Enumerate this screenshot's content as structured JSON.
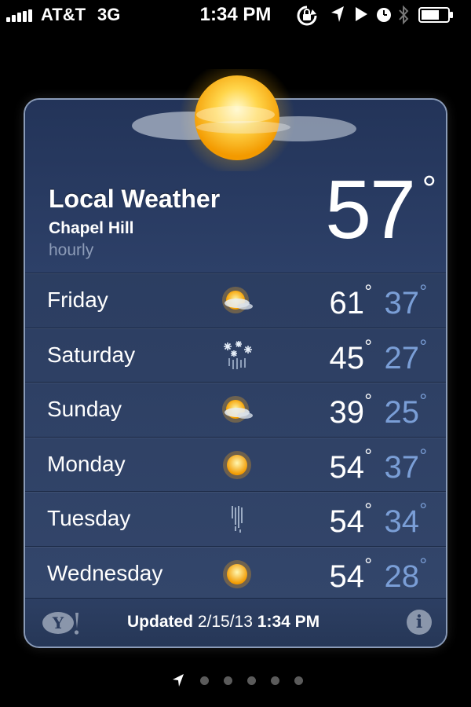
{
  "status_bar": {
    "carrier": "AT&T",
    "network": "3G",
    "time": "1:34 PM",
    "icons": [
      "signal-bars-icon",
      "rotation-lock-icon",
      "location-arrow-icon",
      "play-icon",
      "alarm-clock-icon",
      "bluetooth-icon",
      "battery-icon"
    ]
  },
  "widget": {
    "title": "Local Weather",
    "location": "Chapel Hill",
    "mode": "hourly",
    "current_temp": "57",
    "degree": "°",
    "condition_icon": "partly-cloudy-sun-icon"
  },
  "forecast": [
    {
      "day": "Friday",
      "icon": "partly-cloudy-icon",
      "high": "61",
      "low": "37"
    },
    {
      "day": "Saturday",
      "icon": "snow-icon",
      "high": "45",
      "low": "27"
    },
    {
      "day": "Sunday",
      "icon": "partly-cloudy-icon",
      "high": "39",
      "low": "25"
    },
    {
      "day": "Monday",
      "icon": "sunny-icon",
      "high": "54",
      "low": "37"
    },
    {
      "day": "Tuesday",
      "icon": "rain-icon",
      "high": "54",
      "low": "34"
    },
    {
      "day": "Wednesday",
      "icon": "sunny-icon",
      "high": "54",
      "low": "28"
    }
  ],
  "footer": {
    "updated_label": "Updated",
    "date": "2/15/13",
    "time": "1:34 PM",
    "yahoo_icon": "yahoo-logo-icon",
    "info_icon": "info-icon"
  },
  "pager": {
    "icons": [
      "location-arrow-icon"
    ],
    "dots": 5,
    "active": 0
  },
  "colors": {
    "card": "#2b3d62",
    "low_temp": "#7a9ed6",
    "sun": "#ffc21a"
  }
}
